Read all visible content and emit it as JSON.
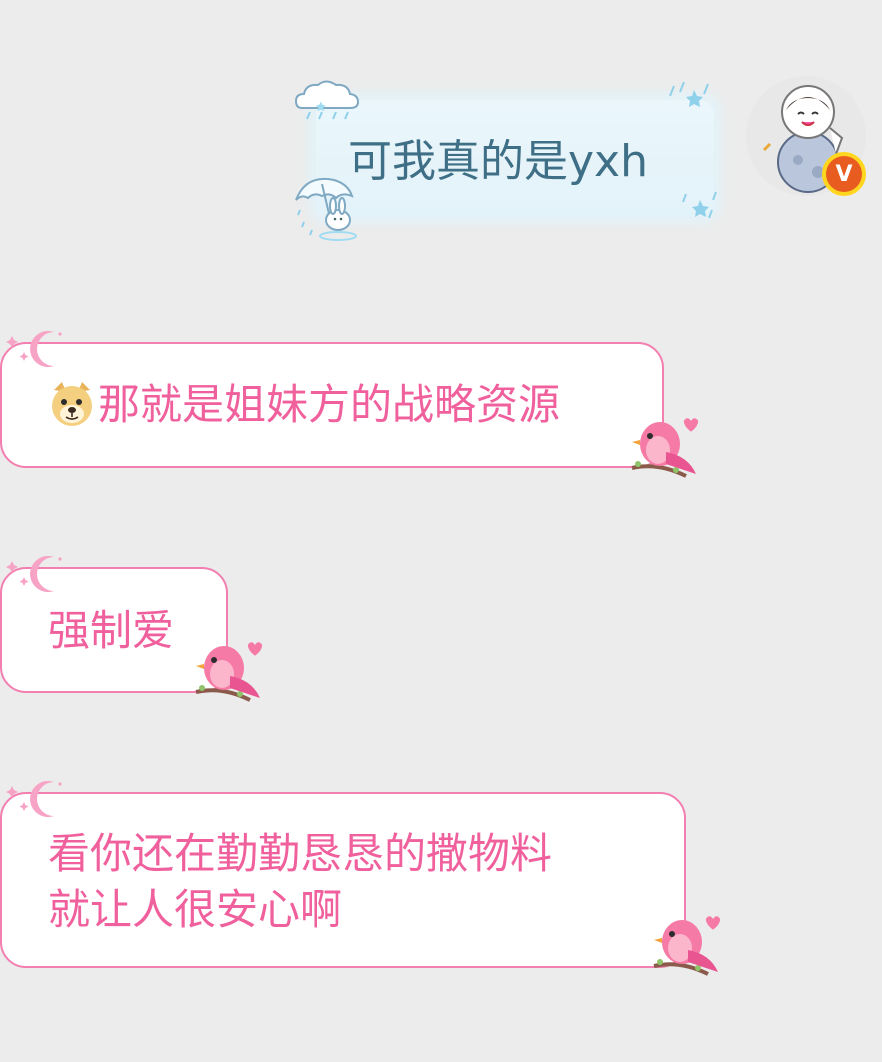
{
  "chat": {
    "outgoing": [
      {
        "text": "可我真的是yxh",
        "icons": [
          "cloud-icon",
          "umbrella-bunny-icon",
          "rain-sparkle-icon"
        ]
      }
    ],
    "avatar": {
      "badge": "V"
    },
    "incoming": [
      {
        "emoji": "doge-emoji",
        "text": "那就是姐妹方的战略资源"
      },
      {
        "text": "强制爱"
      },
      {
        "lines": [
          "看你还在勤勤恳恳的撒物料",
          "就让人很安心啊"
        ]
      }
    ]
  },
  "colors": {
    "background": "#ececec",
    "outgoing_bubble": "#e3f3fa",
    "outgoing_text": "#3f6f86",
    "incoming_bubble_border": "#f27fb0",
    "incoming_text": "#f0609c",
    "vip_badge": "#e85c1f"
  }
}
